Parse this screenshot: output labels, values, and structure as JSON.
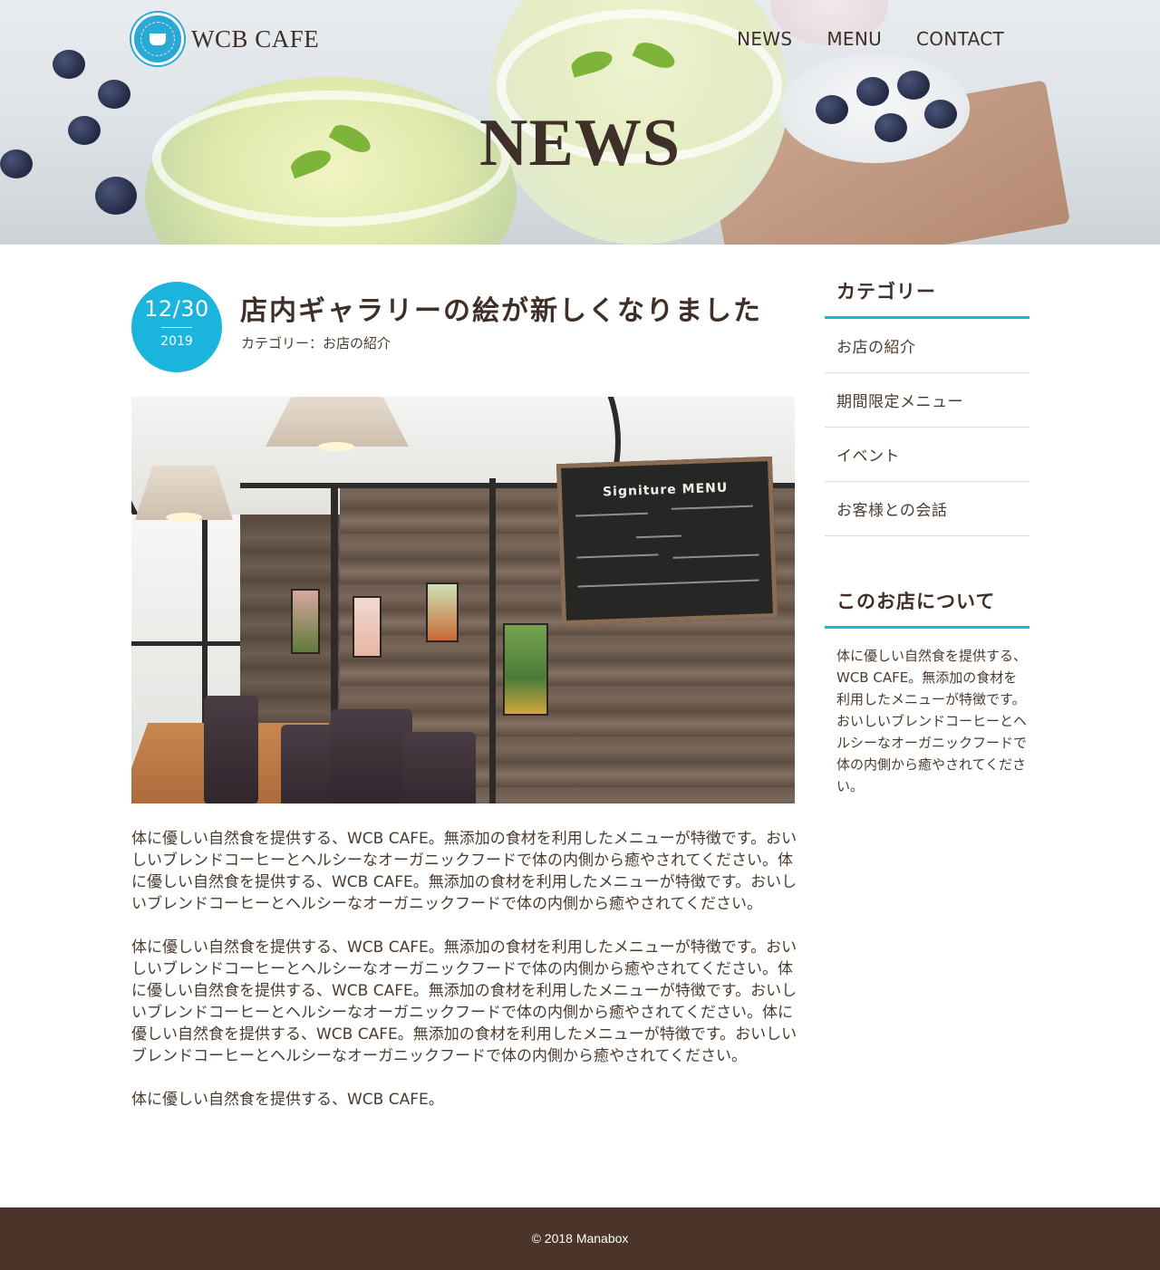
{
  "site": {
    "logo_text": "WCB CAFE",
    "logo_ring_text": "WCB Cafe since 2018",
    "brand_color": "#1ab4dc",
    "text_color": "#4a3b2f",
    "footer_bg": "#4a3528"
  },
  "nav": {
    "items": [
      {
        "label": "NEWS"
      },
      {
        "label": "MENU"
      },
      {
        "label": "CONTACT"
      }
    ]
  },
  "hero": {
    "title": "NEWS"
  },
  "post": {
    "date_md": "12/30",
    "date_year": "2019",
    "title": "店内ギャラリーの絵が新しくなりました",
    "category_line": "カテゴリー：お店の紹介",
    "board_title": "Signiture MENU",
    "paragraphs": [
      "体に優しい自然食を提供する、WCB CAFE。無添加の食材を利用したメニューが特徴です。おいしいブレンドコーヒーとヘルシーなオーガニックフードで体の内側から癒やされてください。体に優しい自然食を提供する、WCB CAFE。無添加の食材を利用したメニューが特徴です。おいしいブレンドコーヒーとヘルシーなオーガニックフードで体の内側から癒やされてください。",
      "体に優しい自然食を提供する、WCB CAFE。無添加の食材を利用したメニューが特徴です。おいしいブレンドコーヒーとヘルシーなオーガニックフードで体の内側から癒やされてください。体に優しい自然食を提供する、WCB CAFE。無添加の食材を利用したメニューが特徴です。おいしいブレンドコーヒーとヘルシーなオーガニックフードで体の内側から癒やされてください。体に優しい自然食を提供する、WCB CAFE。無添加の食材を利用したメニューが特徴です。おいしいブレンドコーヒーとヘルシーなオーガニックフードで体の内側から癒やされてください。",
      "体に優しい自然食を提供する、WCB CAFE。"
    ]
  },
  "sidebar": {
    "category_heading": "カテゴリー",
    "categories": [
      {
        "label": "お店の紹介"
      },
      {
        "label": "期間限定メニュー"
      },
      {
        "label": "イベント"
      },
      {
        "label": "お客様との会話"
      }
    ],
    "about_heading": "このお店について",
    "about_text": "体に優しい自然食を提供する、WCB CAFE。無添加の食材を利用したメニューが特徴です。おいしいブレンドコーヒーとヘルシーなオーガニックフードで体の内側から癒やされてください。"
  },
  "footer": {
    "copyright": "© 2018 Manabox"
  }
}
